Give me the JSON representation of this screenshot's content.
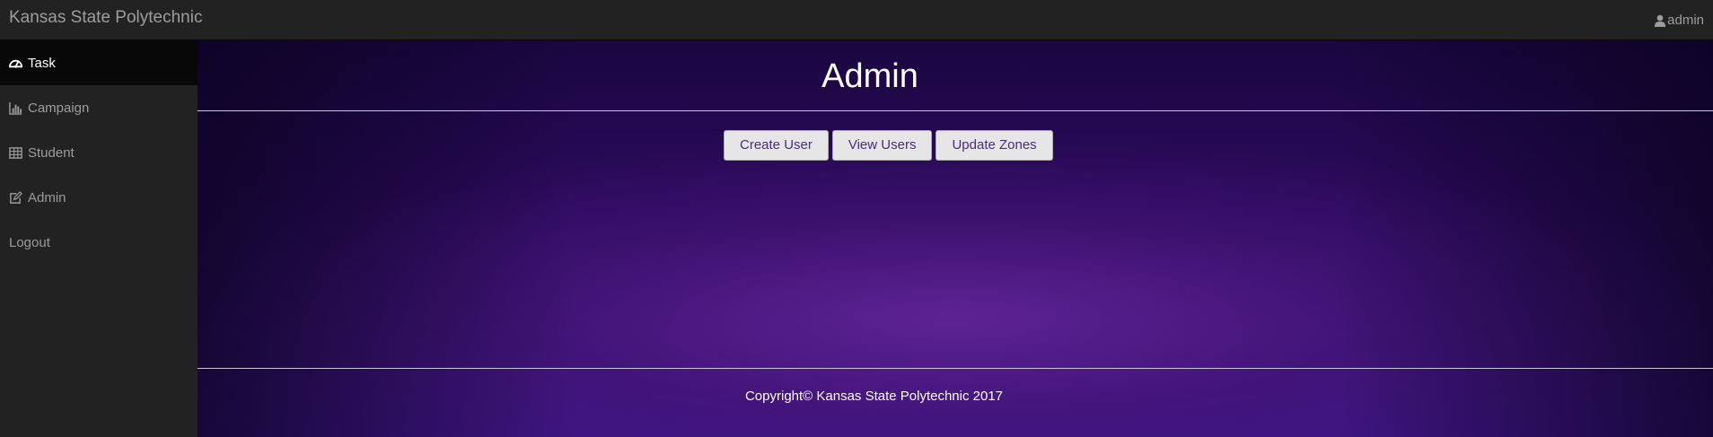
{
  "header": {
    "brand": "Kansas State Polytechnic",
    "user": "admin"
  },
  "sidebar": {
    "items": [
      {
        "label": "Task",
        "icon": "dashboard-icon",
        "active": true
      },
      {
        "label": "Campaign",
        "icon": "bar-chart-icon",
        "active": false
      },
      {
        "label": "Student",
        "icon": "table-icon",
        "active": false
      },
      {
        "label": "Admin",
        "icon": "edit-icon",
        "active": false
      },
      {
        "label": "Logout",
        "icon": "",
        "active": false
      }
    ]
  },
  "main": {
    "title": "Admin",
    "buttons": {
      "create_user": "Create User",
      "view_users": "View Users",
      "update_zones": "Update Zones"
    },
    "footer": "Copyright© Kansas State Polytechnic 2017"
  },
  "colors": {
    "navbar": "#222222",
    "active_item": "#080808",
    "accent_purple": "#3d1585",
    "button_text": "#4a2c7a"
  }
}
